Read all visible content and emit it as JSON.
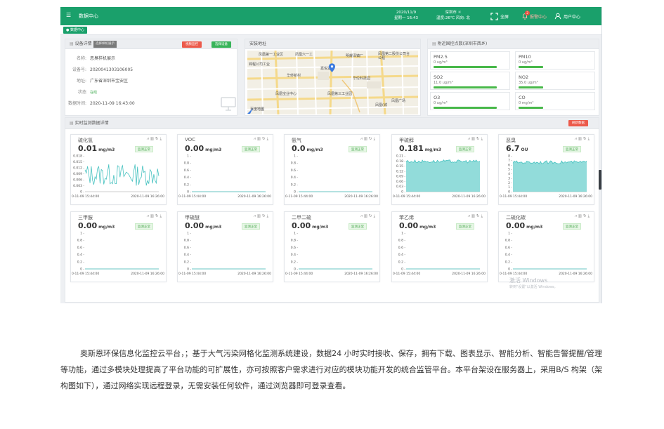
{
  "topbar": {
    "title": "数据中心",
    "date_line1": "2020/11/9",
    "date_line2": "星期一 16:43",
    "weather_line1": "深圳市 ☼",
    "weather_line2": "温度:26℃ 风向: 北",
    "fullscreen_label": "全屏",
    "alarm_label": "报警中心",
    "alarm_badge": "2",
    "user_label": "用户中心"
  },
  "tab": {
    "label": "● 数据中心"
  },
  "device": {
    "title": "设备详情",
    "tooltip": "选择样机展示",
    "btn_monitor": "视频监控",
    "btn_select": "选择设备",
    "rows": [
      {
        "k": "名称:",
        "v": "恶臭样机展示"
      },
      {
        "k": "设备号:",
        "v": "2020041303106005"
      },
      {
        "k": "地址:",
        "v": "广东省深圳市宝安区"
      },
      {
        "k": "状态",
        "v": "在线"
      },
      {
        "k": "数据时间:",
        "v": "2020-11-09 16:43:00"
      }
    ]
  },
  "map": {
    "title": "安装地址",
    "labels": [
      "凤凰第一工业区",
      "凤凰六一工",
      "明耀泽镇厂",
      "凤凰第二股份公司合公程",
      "锦程公司工业",
      "嘉悦酒",
      "华侨新村",
      "华伦科技园",
      "凤凰宝业中心",
      "凤凰第三工业园",
      "凤凰广场",
      "凤凰(城",
      "百度地图"
    ]
  },
  "aqi": {
    "title": "附近国控点数(深圳市西乡)",
    "items": [
      {
        "name": "PM2.5",
        "value": "0 ug/m³",
        "level": 0.9
      },
      {
        "name": "PM10",
        "value": "0 ug/m³",
        "level": 0.35
      },
      {
        "name": "SO2",
        "value": "11.0 ug/m³",
        "level": 0.9
      },
      {
        "name": "NO2",
        "value": "35.0 ug/m³",
        "level": 0.35
      },
      {
        "name": "O3",
        "value": "0 ug/m³",
        "level": 0.9
      },
      {
        "name": "CO",
        "value": "0 mg/m³",
        "level": 0.35
      }
    ]
  },
  "realtime": {
    "title": "实时监测数据详情",
    "refresh_label": "刷新数据",
    "normal_label": "监测正常",
    "watermark1": "激活 Windows",
    "watermark2": "转到\"设置\"以激活 Windows。"
  },
  "chart_data": [
    {
      "type": "line",
      "name": "硫化氢",
      "value": "0.01",
      "unit": "mg/m3",
      "yticks": [
        "0.018 -",
        "0.015 -",
        "0.012 -",
        "0.009 -",
        "0.006 -",
        "0.003 -",
        "0 -"
      ],
      "x": [
        "2020-11-09 15:44:00",
        "2020-11-09 16:26:00"
      ],
      "ylim": [
        0,
        0.018
      ],
      "pattern": "spiky"
    },
    {
      "type": "line",
      "name": "VOC",
      "value": "0.00",
      "unit": "mg/m3",
      "yticks": [
        "1 -",
        "0.8 -",
        "0.6 -",
        "0.4 -",
        "0.2 -",
        "0 -"
      ],
      "x": [
        "2020-11-09 15:44:00",
        "2020-11-09 16:26:00"
      ],
      "ylim": [
        0,
        1
      ],
      "pattern": "flat"
    },
    {
      "type": "line",
      "name": "氨气",
      "value": "0.0",
      "unit": "mg/m3",
      "yticks": [
        "1 -",
        "0.8 -",
        "0.6 -",
        "0.4 -",
        "0.2 -",
        "0 -"
      ],
      "x": [
        "2020-11-09 15:44:00",
        "2020-11-09 16:26:00"
      ],
      "ylim": [
        0,
        1
      ],
      "pattern": "flat"
    },
    {
      "type": "area",
      "name": "甲硫醇",
      "value": "0.181",
      "unit": "mg/m3",
      "yticks": [
        "0.21 -",
        "0.18 -",
        "0.15 -",
        "0.12 -",
        "0.09 -",
        "0.06 -",
        "0.03 -",
        "0 -"
      ],
      "x": [
        "2020-11-09 15:44:00",
        "2020-11-09 16:26:00"
      ],
      "ylim": [
        0,
        0.21
      ],
      "pattern": "high",
      "level": 0.181
    },
    {
      "type": "area",
      "name": "恶臭",
      "value": "6.7",
      "unit": "OU",
      "yticks": [
        "8 -",
        "7 -",
        "6 -",
        "5 -",
        "4 -",
        "3 -",
        "2 -",
        "1 -",
        "0 -"
      ],
      "x": [
        "2020-11-09 15:44:00",
        "2020-11-09 16:26:00"
      ],
      "ylim": [
        0,
        8
      ],
      "pattern": "high",
      "level": 6.7
    },
    {
      "type": "line",
      "name": "三甲胺",
      "value": "0.00",
      "unit": "mg/m3",
      "yticks": [
        "1 -",
        "0.8 -",
        "0.6 -",
        "0.4 -",
        "0.2 -",
        "0 -"
      ],
      "x": [
        "2020-11-09 15:44:00",
        "2020-11-09 16:26:00"
      ],
      "ylim": [
        0,
        1
      ],
      "pattern": "flat"
    },
    {
      "type": "line",
      "name": "甲硫醚",
      "value": "0.00",
      "unit": "mg/m3",
      "yticks": [
        "1 -",
        "0.8 -",
        "0.6 -",
        "0.4 -",
        "0.2 -",
        "0 -"
      ],
      "x": [
        "2020-11-09 15:44:00",
        "2020-11-09 16:26:00"
      ],
      "ylim": [
        0,
        1
      ],
      "pattern": "flat"
    },
    {
      "type": "line",
      "name": "二甲二硫",
      "value": "0.00",
      "unit": "mg/m3",
      "yticks": [
        "1 -",
        "0.8 -",
        "0.6 -",
        "0.4 -",
        "0.2 -",
        "0 -"
      ],
      "x": [
        "2020-11-09 15:44:00",
        "2020-11-09 16:26:00"
      ],
      "ylim": [
        0,
        1
      ],
      "pattern": "flat"
    },
    {
      "type": "line",
      "name": "苯乙烯",
      "value": "0.00",
      "unit": "mg/m3",
      "yticks": [
        "1 -",
        "0.8 -",
        "0.6 -",
        "0.4 -",
        "0.2 -",
        "0 -"
      ],
      "x": [
        "2020-11-09 15:44:00",
        "2020-11-09 16:26:00"
      ],
      "ylim": [
        0,
        1
      ],
      "pattern": "flat"
    },
    {
      "type": "line",
      "name": "二硫化碳",
      "value": "0.00",
      "unit": "mg/m3",
      "yticks": [
        "1 -",
        "0.8 -",
        "0.6 -",
        "0.4 -",
        "0.2 -",
        "0 -"
      ],
      "x": [
        "2020-11-09 15:44:00",
        "2020-11-09 16:26:00"
      ],
      "ylim": [
        0,
        1
      ],
      "pattern": "flat"
    }
  ],
  "paragraph": "奥斯恩环保信息化监控云平台，；基于大气污染网格化监测系统建设，数据24 小时实时接收、保存，拥有下载、图表显示、智能分析、智能告警提醒/管理等功能，通过多模块处理提高了平台功能的可扩展性，亦可按照客户需求进行对应的模块功能开发的统合监管平台。本平台架设在服务器上，采用B/S  构架（架构图如下），通过网络实现远程登录，无需安装任何软件，通过浏览器即可登录查看。"
}
